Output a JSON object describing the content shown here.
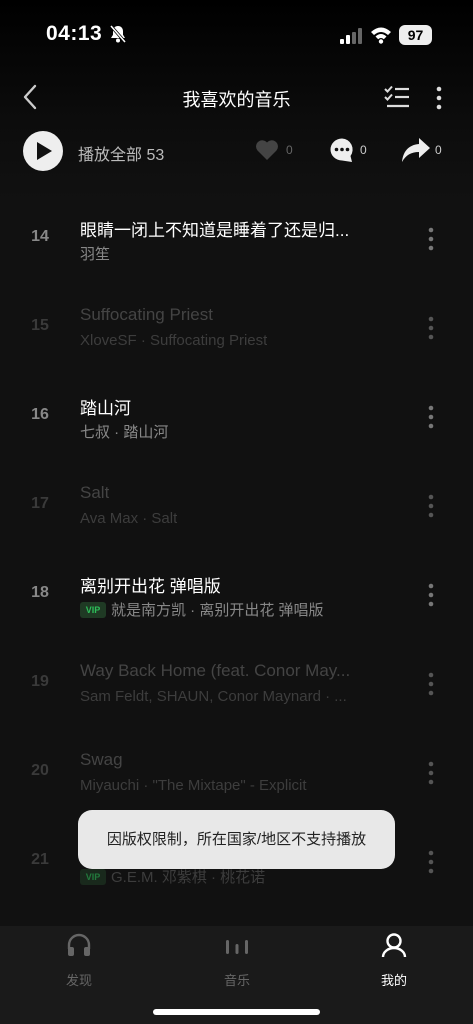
{
  "status_bar": {
    "time": "04:13",
    "battery": "97"
  },
  "nav": {
    "title": "我喜欢的音乐"
  },
  "toolbar": {
    "play_all_label": "播放全部 53",
    "like_count": "0",
    "comment_count": "0",
    "share_count": "0"
  },
  "songs": [
    {
      "num": "14",
      "title": "眼睛一闭上不知道是睡着了还是归...",
      "subtitle": "羽笙",
      "vip": false,
      "available": true
    },
    {
      "num": "15",
      "title": "Suffocating Priest",
      "subtitle": "XloveSF · Suffocating Priest",
      "vip": false,
      "available": false
    },
    {
      "num": "16",
      "title": "踏山河",
      "subtitle": "七叔 · 踏山河",
      "vip": false,
      "available": true
    },
    {
      "num": "17",
      "title": "Salt",
      "subtitle": "Ava Max · Salt",
      "vip": false,
      "available": false
    },
    {
      "num": "18",
      "title": "离别开出花 弹唱版",
      "subtitle": "就是南方凯 · 离别开出花 弹唱版",
      "vip": true,
      "available": true
    },
    {
      "num": "19",
      "title": "Way Back Home (feat. Conor May...",
      "subtitle": "Sam Feldt, SHAUN, Conor Maynard · ...",
      "vip": false,
      "available": false
    },
    {
      "num": "20",
      "title": "Swag",
      "subtitle": "Miyauchi · \"The Mixtape\" - Explicit",
      "vip": false,
      "available": false
    },
    {
      "num": "21",
      "title": "",
      "subtitle": "G.E.M. 邓紫棋 · 桃花诺",
      "vip": true,
      "available": false
    }
  ],
  "vip_badge": "VIP",
  "toast": "因版权限制，所在国家/地区不支持播放",
  "tabs": [
    {
      "label": "发现",
      "icon": "headphones-icon",
      "active": false
    },
    {
      "label": "音乐",
      "icon": "music-bars-icon",
      "active": false
    },
    {
      "label": "我的",
      "icon": "person-icon",
      "active": true
    }
  ]
}
